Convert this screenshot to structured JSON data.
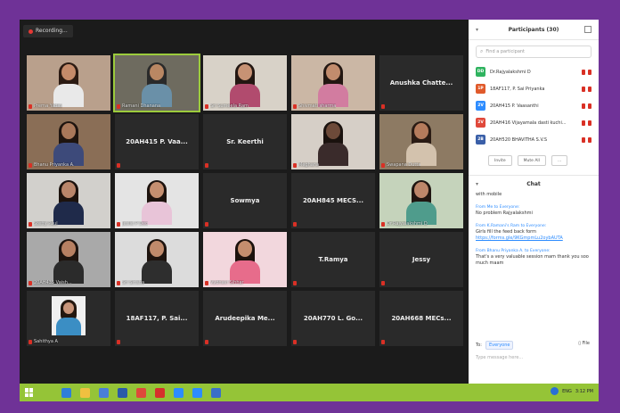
{
  "recording": {
    "label": "Recording..."
  },
  "tiles": [
    {
      "name": "Prerna Yadav",
      "type": "video",
      "skin": "#c58b6a",
      "hair": "#2b1a12",
      "cloth": "#e9e9e9",
      "bg": "#b9a08c"
    },
    {
      "name": "Ramani Dhanana",
      "type": "video",
      "selected": true,
      "skin": "#b98763",
      "hair": "#2a2a2a",
      "cloth": "#6a90a8",
      "bg": "#6e6b5f"
    },
    {
      "name": "Sri Sumeela Ram",
      "type": "video",
      "skin": "#c79274",
      "hair": "#231712",
      "cloth": "#b14b6e",
      "bg": "#d8d2c8"
    },
    {
      "name": "Shivmati sharma",
      "type": "video",
      "skin": "#c28c6d",
      "hair": "#231712",
      "cloth": "#d27ca0",
      "bg": "#cbb7a5"
    },
    {
      "name": "Anushka Chatte...",
      "type": "text"
    },
    {
      "name": "Bhanu Priyanka A.",
      "type": "video",
      "skin": "#a9785a",
      "hair": "#1e140f",
      "cloth": "#3d4a7a",
      "bg": "#8a6e56"
    },
    {
      "name": "20AH415 P. Vaa...",
      "type": "text"
    },
    {
      "name": "Sr. Keerthi",
      "type": "text"
    },
    {
      "name": "Meghana",
      "type": "video",
      "skin": "#6d4a39",
      "hair": "#1a120e",
      "cloth": "#3a2b2b",
      "bg": "#d6cfc7"
    },
    {
      "name": "Swapana Dutta",
      "type": "video",
      "skin": "#b57b5c",
      "hair": "#2a1b14",
      "cloth": "#d3c2ad",
      "bg": "#8d7a63"
    },
    {
      "name": "Steffy Paul",
      "type": "video",
      "skin": "#b9856a",
      "hair": "#1c120d",
      "cloth": "#1f2a4a",
      "bg": "#d2d0cc"
    },
    {
      "name": "Jeslie P Deo",
      "type": "video",
      "skin": "#c58f70",
      "hair": "#1d130e",
      "cloth": "#e8c4d8",
      "bg": "#e4e4e4"
    },
    {
      "name": "Sowmya",
      "type": "text"
    },
    {
      "name": "20AH845 MECS...",
      "type": "text"
    },
    {
      "name": "Dr.Rajyalakshmi D",
      "type": "video",
      "skin": "#bd876a",
      "hair": "#201611",
      "cloth": "#4f9c8c",
      "bg": "#c5d3bb"
    },
    {
      "name": "20AH435 Vaish...",
      "type": "video",
      "skin": "#b78062",
      "hair": "#1e140f",
      "cloth": "#2b2b2b",
      "bg": "#a9a9a9"
    },
    {
      "name": "Sri Sirisha",
      "type": "video",
      "skin": "#c08a6b",
      "hair": "#1e140f",
      "cloth": "#2e2e2e",
      "bg": "#dcdcdc"
    },
    {
      "name": "Vydhavi Sihhar",
      "type": "video",
      "skin": "#c48e6e",
      "hair": "#1c120d",
      "cloth": "#e76c8b",
      "bg": "#f2d7dd"
    },
    {
      "name": "T.Ramya",
      "type": "text"
    },
    {
      "name": "Jessy",
      "type": "text"
    },
    {
      "name": "Sahithya A",
      "type": "photo",
      "skin": "#c9957a",
      "hair": "#23170f",
      "cloth": "#3b8ec4",
      "bg": "#f0f0f0"
    },
    {
      "name": "18AF117, P. Sai...",
      "type": "text"
    },
    {
      "name": "Arudeepika Me...",
      "type": "text"
    },
    {
      "name": "20AH770 L. Go...",
      "type": "text"
    },
    {
      "name": "20AH668 MECs...",
      "type": "text"
    }
  ],
  "participants": {
    "title": "Participants (30)",
    "search_placeholder": "Find a participant",
    "items": [
      {
        "initials": "DD",
        "name": "Dr.Rajyalakshmi D",
        "color": "#2fb35f"
      },
      {
        "initials": "1P",
        "name": "18AF117, P. Sai Priyanka",
        "color": "#e05a2b"
      },
      {
        "initials": "2V",
        "name": "20AH415 P. Vaasanthi",
        "color": "#2d8cff"
      },
      {
        "initials": "2V",
        "name": "20AH416 Vijayamala dasti kuchi...",
        "color": "#e0483a"
      },
      {
        "initials": "2B",
        "name": "20AH520 BHAVITHA S.V.S",
        "color": "#3a5fa8"
      }
    ],
    "invite": "Invite",
    "mute_all": "Mute All",
    "more": "..."
  },
  "chat": {
    "title": "Chat",
    "messages": [
      {
        "from": "",
        "text": "with mobile"
      },
      {
        "from": "From Me to Everyone:",
        "text": "No problem Rajyalakshmi"
      },
      {
        "from": "From K.Ramani's Ram to Everyone:",
        "text": "Girls fill the feed back form",
        "link": "https://forms.gle/9KGmpmLu2oybAUTA"
      },
      {
        "from": "From Bhanu Priyanka A. to Everyone:",
        "text": "That's a very valuable session mam thank you soo much maam"
      }
    ],
    "to_label": "To:",
    "to_value": "Everyone",
    "file_label": "File",
    "placeholder": "Type message here..."
  },
  "taskbar": {
    "icons": [
      {
        "name": "edge-icon",
        "color": "#2f7fd9"
      },
      {
        "name": "file-explorer-icon",
        "color": "#f0c040"
      },
      {
        "name": "store-icon",
        "color": "#4a7ed8"
      },
      {
        "name": "word-icon",
        "color": "#2a5aa8"
      },
      {
        "name": "chrome-icon",
        "color": "#de4a3a"
      },
      {
        "name": "acrobat-icon",
        "color": "#d6312b"
      },
      {
        "name": "zoom-meetings-icon",
        "color": "#2d8cff"
      },
      {
        "name": "zoom-app-icon",
        "color": "#2d8cff"
      },
      {
        "name": "mail-icon",
        "color": "#3a6fc8"
      }
    ],
    "lang": "ENG",
    "time": "3:12 PM"
  }
}
